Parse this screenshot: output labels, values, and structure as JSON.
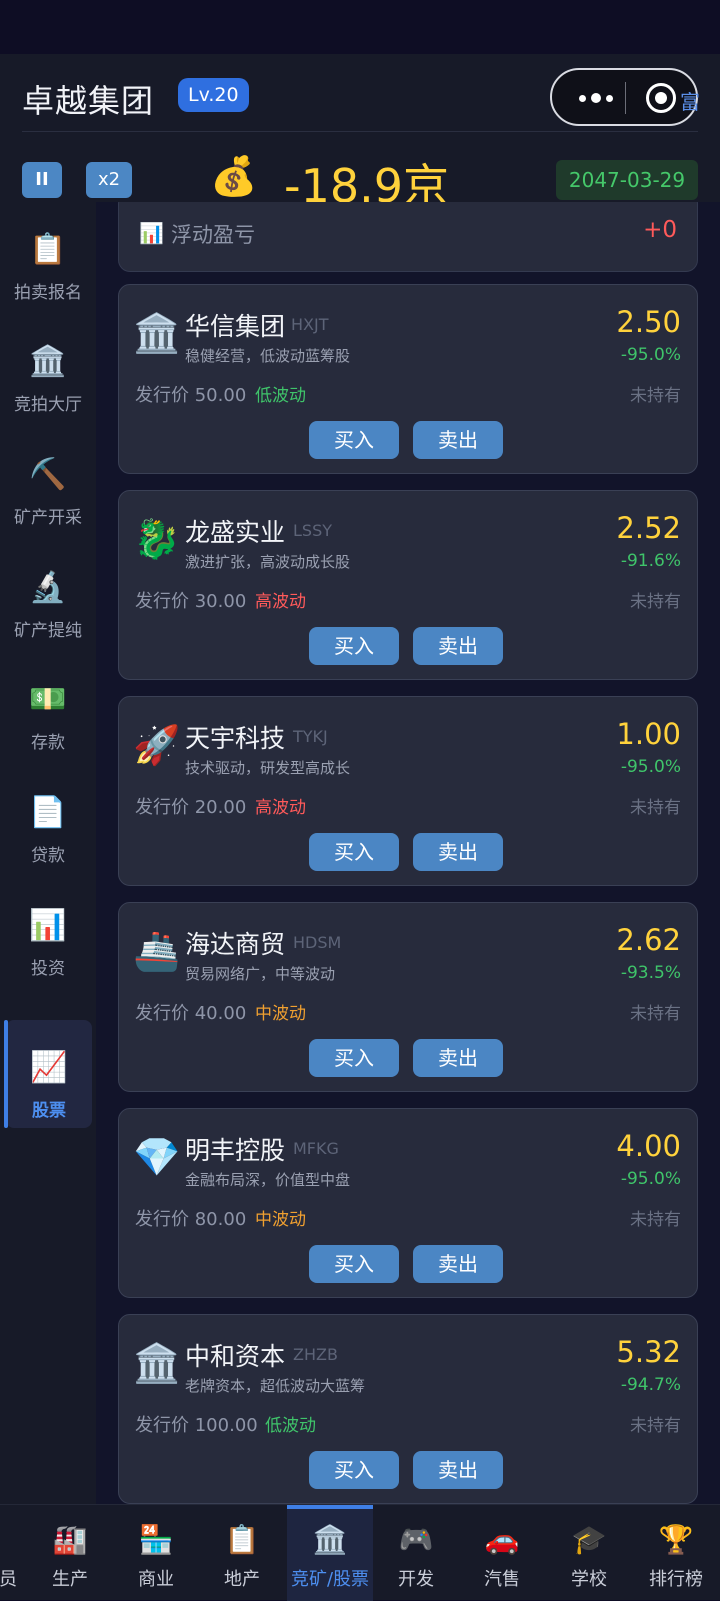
{
  "header": {
    "title": "卓越集团",
    "level": "Lv.20",
    "capsule_overlap_text": "富"
  },
  "toolbar": {
    "pause_label": "II",
    "speed_label": "x2",
    "money_icon": "money-bag-icon",
    "money_value": "-18.9京",
    "date": "2047-03-29"
  },
  "sidebar": {
    "items": [
      {
        "label": "拍卖报名",
        "icon": "📋"
      },
      {
        "label": "竞拍大厅",
        "icon": "🏛️"
      },
      {
        "label": "矿产开采",
        "icon": "⛏️"
      },
      {
        "label": "矿产提纯",
        "icon": "🔬"
      },
      {
        "label": "存款",
        "icon": "💵"
      },
      {
        "label": "贷款",
        "icon": "📄"
      },
      {
        "label": "投资",
        "icon": "📊"
      },
      {
        "label": "股票",
        "icon": "📈"
      }
    ],
    "active_index": 7
  },
  "pnl": {
    "label": "浮动盈亏",
    "value": "+0"
  },
  "stocks": [
    {
      "name": "华信集团",
      "code": "HXJT",
      "desc": "稳健经营，低波动蓝筹股",
      "price": "2.50",
      "change": "-95.0%",
      "issue_label": "发行价",
      "issue_price": "50.00",
      "volatility": "低波动",
      "holding": "未持有",
      "logo": "🏛️"
    },
    {
      "name": "龙盛实业",
      "code": "LSSY",
      "desc": "激进扩张，高波动成长股",
      "price": "2.52",
      "change": "-91.6%",
      "issue_label": "发行价",
      "issue_price": "30.00",
      "volatility": "高波动",
      "holding": "未持有",
      "logo": "🐉"
    },
    {
      "name": "天宇科技",
      "code": "TYKJ",
      "desc": "技术驱动，研发型高成长",
      "price": "1.00",
      "change": "-95.0%",
      "issue_label": "发行价",
      "issue_price": "20.00",
      "volatility": "高波动",
      "holding": "未持有",
      "logo": "🚀"
    },
    {
      "name": "海达商贸",
      "code": "HDSM",
      "desc": "贸易网络广，中等波动",
      "price": "2.62",
      "change": "-93.5%",
      "issue_label": "发行价",
      "issue_price": "40.00",
      "volatility": "中波动",
      "holding": "未持有",
      "logo": "🚢"
    },
    {
      "name": "明丰控股",
      "code": "MFKG",
      "desc": "金融布局深，价值型中盘",
      "price": "4.00",
      "change": "-95.0%",
      "issue_label": "发行价",
      "issue_price": "80.00",
      "volatility": "中波动",
      "holding": "未持有",
      "logo": "💎"
    },
    {
      "name": "中和资本",
      "code": "ZHZB",
      "desc": "老牌资本，超低波动大蓝筹",
      "price": "5.32",
      "change": "-94.7%",
      "issue_label": "发行价",
      "issue_price": "100.00",
      "volatility": "低波动",
      "holding": "未持有",
      "logo": "🏛️"
    }
  ],
  "buttons": {
    "buy": "买入",
    "sell": "卖出"
  },
  "bottom_nav": {
    "items": [
      {
        "label": "人员",
        "icon": ""
      },
      {
        "label": "生产",
        "icon": "🏭"
      },
      {
        "label": "商业",
        "icon": "🏪"
      },
      {
        "label": "地产",
        "icon": "📋"
      },
      {
        "label": "竞矿/股票",
        "icon": "🏛️"
      },
      {
        "label": "开发",
        "icon": "🎮"
      },
      {
        "label": "汽售",
        "icon": "🚗"
      },
      {
        "label": "学校",
        "icon": "🎓"
      },
      {
        "label": "排行榜",
        "icon": "🏆"
      }
    ],
    "active_index": 4
  },
  "colors": {
    "accent": "#3f7fe6",
    "price": "#ffd23c",
    "up": "#3fc46a",
    "down": "#ff5a5a",
    "mid_volatility": "#f0a030"
  }
}
